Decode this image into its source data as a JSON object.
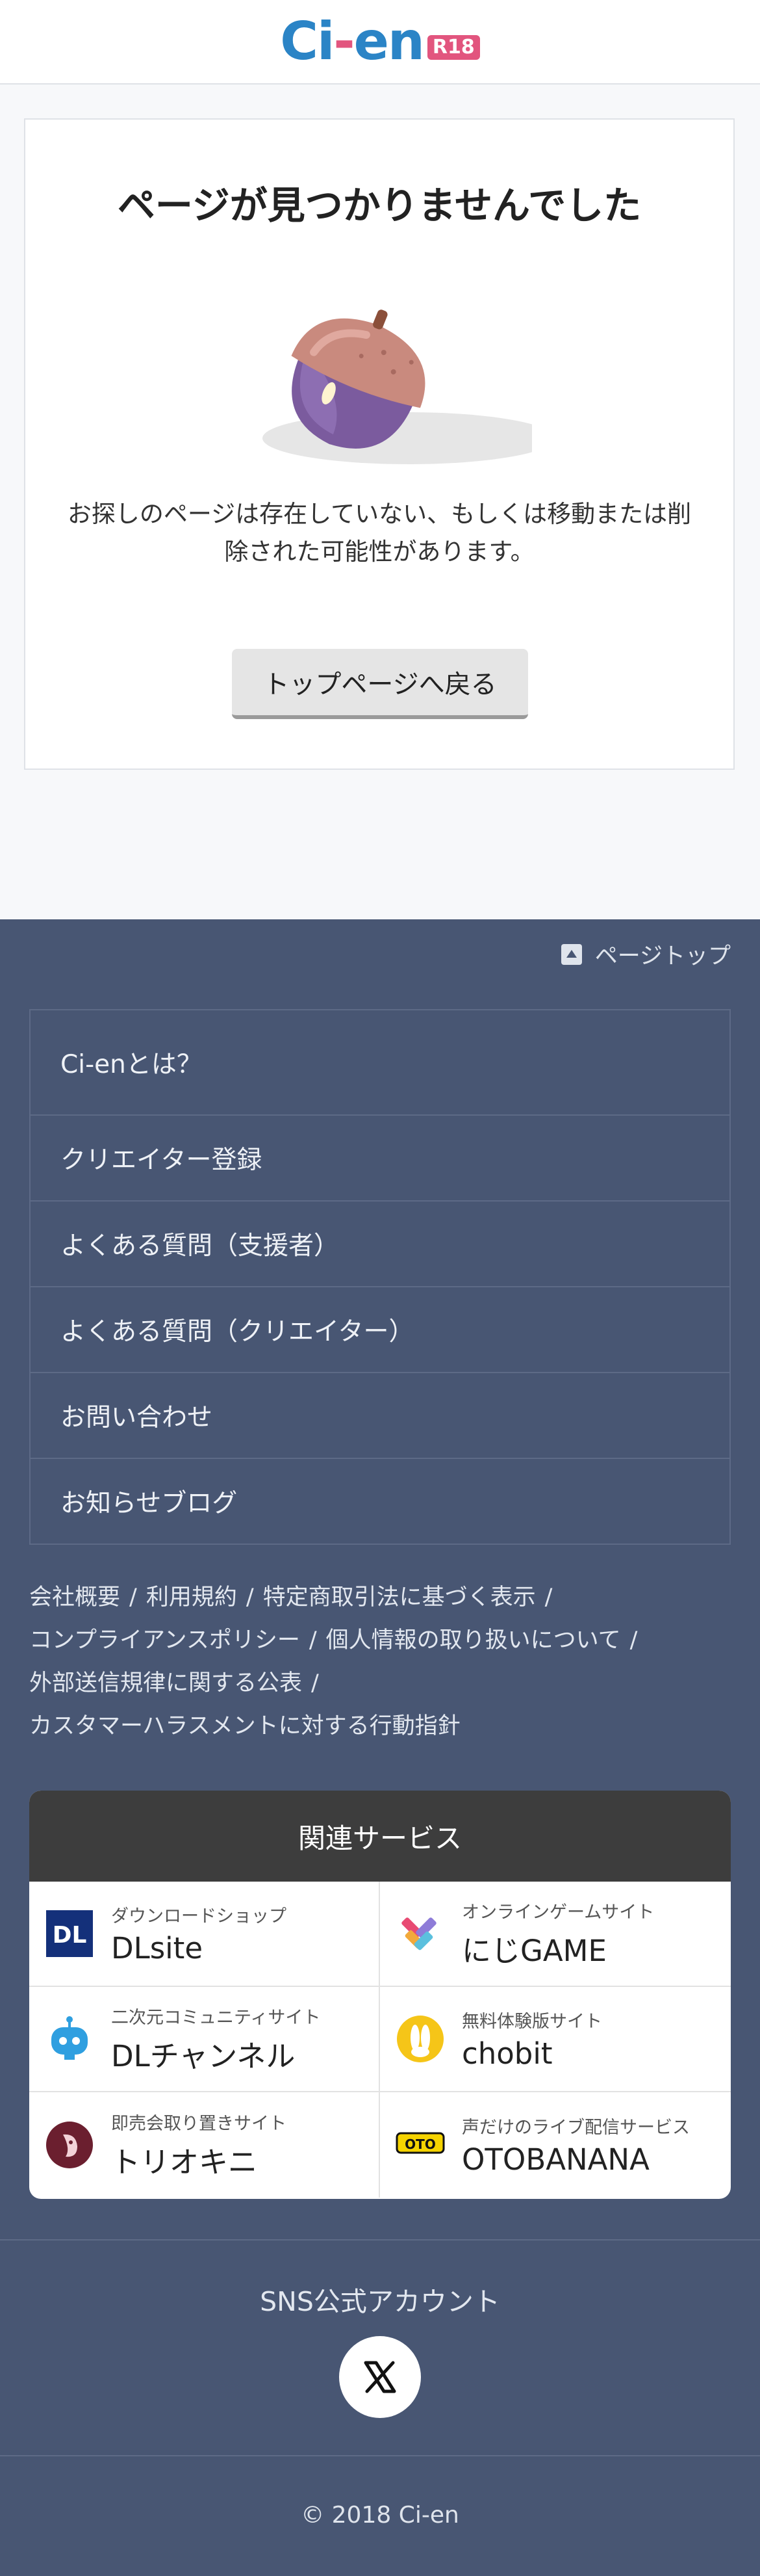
{
  "header": {
    "logo_main": "Ci-en",
    "logo_badge": "R18"
  },
  "error": {
    "title": "ページが見つかりませんでした",
    "message": "お探しのページは存在していない、もしくは移動または削除された可能性があります。",
    "back_button": "トップページへ戻る"
  },
  "footer": {
    "page_top": "ページトップ",
    "menu": [
      "Ci-enとは？",
      "クリエイター登録",
      "よくある質問（支援者）",
      "よくある質問（クリエイター）",
      "お問い合わせ",
      "お知らせブログ"
    ],
    "legal_links": [
      "会社概要",
      "利用規約",
      "特定商取引法に基づく表示",
      "コンプライアンスポリシー",
      "個人情報の取り扱いについて",
      "外部送信規律に関する公表",
      "カスタマーハラスメントに対する行動指針"
    ],
    "legal_separator": "/",
    "related_title": "関連サービス",
    "services": [
      {
        "sub": "ダウンロードショップ",
        "name": "DLsite",
        "icon": "dlsite-icon",
        "icon_text": "DL"
      },
      {
        "sub": "オンラインゲームサイト",
        "name": "にじGAME",
        "icon": "nijigame-icon"
      },
      {
        "sub": "二次元コミュニティサイト",
        "name": "DLチャンネル",
        "icon": "dlchannel-icon"
      },
      {
        "sub": "無料体験版サイト",
        "name": "chobit",
        "icon": "chobit-icon"
      },
      {
        "sub": "即売会取り置きサイト",
        "name": "トリオキニ",
        "icon": "torioki-icon"
      },
      {
        "sub": "声だけのライブ配信サービス",
        "name": "OTOBANANA",
        "icon": "otobanana-icon",
        "icon_text": "OTO"
      }
    ],
    "sns_title": "SNS公式アカウント",
    "copyright": "© 2018 Ci-en"
  },
  "colors": {
    "brand_blue": "#2b84c6",
    "brand_pink": "#e2557e",
    "footer_bg": "#485673",
    "related_head": "#3d3d3d"
  }
}
